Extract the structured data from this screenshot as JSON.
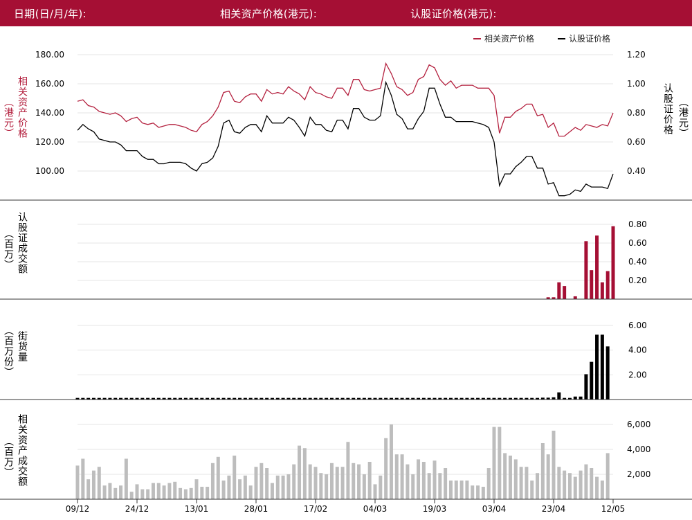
{
  "header": {
    "date_label": "日期(日/月/年):",
    "asset_price_label": "相关资产价格(港元):",
    "warrant_price_label": "认股证价格(港元):"
  },
  "labels": {
    "price_left_name": "相关资产价格",
    "price_left_unit": "（港元）",
    "price_right_name": "认股证价格",
    "price_right_unit": "（港元）",
    "warrant_turnover_name": "认股证成交额",
    "warrant_turnover_unit": "（百万）",
    "outstanding_name": "街货量",
    "outstanding_unit": "（百万份）",
    "asset_turnover_name": "相关资产成交额",
    "asset_turnover_unit": "（百万）"
  },
  "colors": {
    "brand": "#a50f34",
    "asset_line": "#b4213f",
    "warrant_line": "#000000",
    "asset_turnover_bar": "#bdbdbd"
  },
  "chart_data": [
    {
      "type": "line",
      "x_ticks": [
        "09/12",
        "24/12",
        "13/01",
        "28/01",
        "17/02",
        "04/03",
        "19/03",
        "03/04",
        "23/04",
        "12/05"
      ],
      "legend_position": "top-right",
      "series": [
        {
          "name": "相关资产价格",
          "axis": "left",
          "values": [
            148,
            149,
            145,
            144,
            141,
            140,
            139,
            140,
            138,
            134,
            136,
            137,
            133,
            132,
            133,
            130,
            131,
            132,
            132,
            131,
            130,
            128,
            127,
            132,
            134,
            138,
            144,
            154,
            155,
            148,
            147,
            151,
            153,
            153,
            148,
            156,
            153,
            154,
            153,
            158,
            155,
            153,
            149,
            158,
            154,
            153,
            151,
            150,
            157,
            157,
            152,
            163,
            163,
            156,
            155,
            156,
            157,
            174,
            167,
            158,
            156,
            152,
            154,
            163,
            165,
            173,
            171,
            163,
            159,
            162,
            157,
            159,
            159,
            159,
            157,
            157,
            157,
            152,
            126,
            137,
            137,
            141,
            143,
            146,
            146,
            138,
            139,
            130,
            133,
            124,
            124,
            127,
            130,
            128,
            132,
            131,
            130,
            132,
            131,
            140
          ]
        },
        {
          "name": "认股证价格",
          "axis": "right",
          "values": [
            0.68,
            0.72,
            0.69,
            0.67,
            0.62,
            0.61,
            0.6,
            0.6,
            0.58,
            0.54,
            0.54,
            0.54,
            0.5,
            0.48,
            0.48,
            0.45,
            0.45,
            0.46,
            0.46,
            0.46,
            0.45,
            0.42,
            0.4,
            0.45,
            0.46,
            0.49,
            0.57,
            0.73,
            0.75,
            0.67,
            0.66,
            0.7,
            0.72,
            0.72,
            0.67,
            0.78,
            0.73,
            0.73,
            0.73,
            0.77,
            0.75,
            0.7,
            0.64,
            0.77,
            0.72,
            0.72,
            0.68,
            0.67,
            0.75,
            0.75,
            0.69,
            0.83,
            0.83,
            0.77,
            0.75,
            0.75,
            0.78,
            1.01,
            0.92,
            0.79,
            0.76,
            0.69,
            0.69,
            0.76,
            0.81,
            0.97,
            0.97,
            0.86,
            0.77,
            0.77,
            0.74,
            0.74,
            0.74,
            0.74,
            0.73,
            0.72,
            0.7,
            0.6,
            0.3,
            0.38,
            0.38,
            0.43,
            0.46,
            0.5,
            0.5,
            0.42,
            0.42,
            0.31,
            0.32,
            0.23,
            0.23,
            0.24,
            0.27,
            0.26,
            0.31,
            0.29,
            0.29,
            0.29,
            0.28,
            0.38
          ]
        }
      ],
      "y_left": {
        "ticks": [
          "100.00",
          "120.00",
          "140.00",
          "160.00",
          "180.00"
        ],
        "range": [
          91,
          182
        ]
      },
      "y_right": {
        "ticks": [
          "0.40",
          "0.60",
          "0.80",
          "1.00",
          "1.20"
        ],
        "range": [
          0.23,
          1.24
        ]
      },
      "grid": true
    },
    {
      "type": "bar",
      "series_name": "认股证成交额",
      "y_ticks": [
        "0.20",
        "0.40",
        "0.60",
        "0.80"
      ],
      "y_range": [
        0,
        0.9
      ],
      "bars": [
        [
          87,
          0.02
        ],
        [
          88,
          0.02
        ],
        [
          89,
          0.18
        ],
        [
          90,
          0.14
        ],
        [
          92,
          0.03
        ],
        [
          94,
          0.62
        ],
        [
          95,
          0.31
        ],
        [
          96,
          0.68
        ],
        [
          97,
          0.18
        ],
        [
          98,
          0.3
        ],
        [
          99,
          0.78
        ]
      ],
      "grid": true
    },
    {
      "type": "bar",
      "series_name": "街货量",
      "y_ticks": [
        "2.00",
        "4.00",
        "6.00"
      ],
      "y_range": [
        0,
        6.6
      ],
      "values": [
        0.13,
        0.13,
        0.13,
        0.13,
        0.13,
        0.13,
        0.13,
        0.13,
        0.13,
        0.13,
        0.13,
        0.13,
        0.13,
        0.13,
        0.13,
        0.13,
        0.13,
        0.13,
        0.13,
        0.13,
        0.13,
        0.13,
        0.13,
        0.13,
        0.13,
        0.13,
        0.13,
        0.13,
        0.13,
        0.13,
        0.13,
        0.13,
        0.13,
        0.13,
        0.13,
        0.13,
        0.13,
        0.13,
        0.13,
        0.13,
        0.13,
        0.13,
        0.13,
        0.13,
        0.13,
        0.13,
        0.13,
        0.13,
        0.13,
        0.13,
        0.13,
        0.13,
        0.13,
        0.13,
        0.13,
        0.13,
        0.13,
        0.13,
        0.13,
        0.13,
        0.13,
        0.13,
        0.13,
        0.13,
        0.13,
        0.13,
        0.13,
        0.13,
        0.13,
        0.13,
        0.13,
        0.13,
        0.13,
        0.13,
        0.13,
        0.13,
        0.13,
        0.13,
        0.13,
        0.13,
        0.13,
        0.13,
        0.13,
        0.13,
        0.13,
        0.13,
        0.15,
        0.15,
        0.18,
        0.58,
        0.13,
        0.13,
        0.24,
        0.24,
        2.05,
        3.05,
        5.25,
        5.25,
        4.3
      ],
      "grid": true
    },
    {
      "type": "bar",
      "series_name": "相关资产成交额",
      "y_ticks": [
        "2,000",
        "4,000",
        "6,000"
      ],
      "y_range": [
        0,
        6500
      ],
      "values": [
        2700,
        3250,
        1600,
        2300,
        2600,
        1100,
        1300,
        900,
        1100,
        3250,
        600,
        1200,
        800,
        800,
        1300,
        1300,
        1100,
        1300,
        1400,
        900,
        800,
        900,
        1600,
        1000,
        1000,
        2900,
        3400,
        1500,
        1900,
        3500,
        1600,
        1900,
        1100,
        2600,
        2900,
        2500,
        1300,
        1900,
        1900,
        2000,
        2800,
        4300,
        4100,
        2800,
        2600,
        2100,
        2000,
        2900,
        2600,
        2600,
        4600,
        2900,
        2800,
        2000,
        3000,
        1200,
        1900,
        4900,
        6000,
        3600,
        3600,
        2800,
        2000,
        3200,
        3000,
        2100,
        3100,
        2100,
        2500,
        1500,
        1500,
        1500,
        1500,
        1100,
        1100,
        1000,
        2500,
        5800,
        5800,
        3700,
        3500,
        3200,
        2600,
        2600,
        1500,
        2100,
        4500,
        3600,
        5500,
        2600,
        2300,
        2100,
        1800,
        2300,
        2800,
        2500,
        1800,
        1500,
        3700
      ]
    }
  ]
}
